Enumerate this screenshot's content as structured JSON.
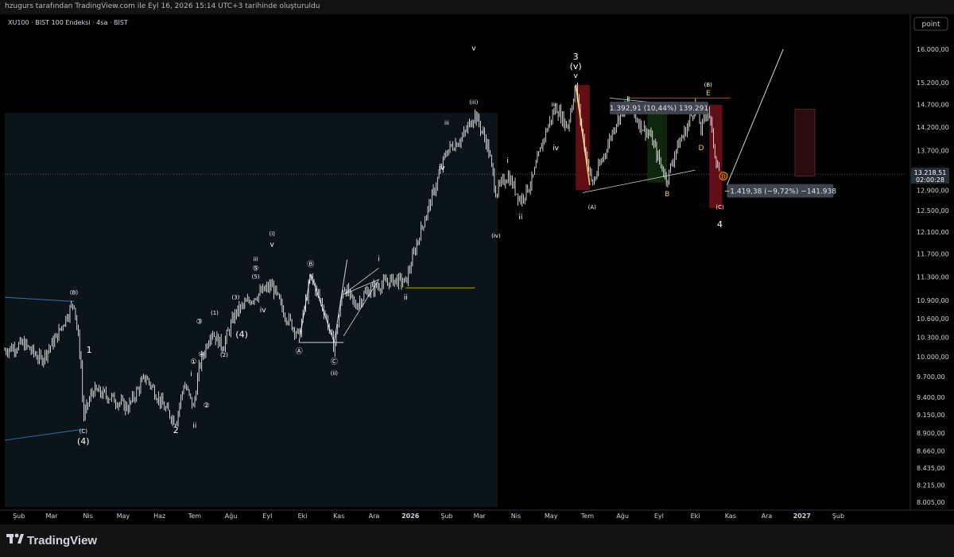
{
  "header": {
    "caption": "hzugurs tarafından TradingView.com ile Eyl 16, 2026 15:14 UTC+3 tarihinde oluşturuldu"
  },
  "chart_title": "XU100 · BIST 100 Endeksi · 4sa · BIST",
  "scale_button": "point",
  "footer": {
    "brand": "TradingView"
  },
  "colors": {
    "background": "#000000",
    "candle": "#ffffff",
    "highlight_zone": "#0b1418",
    "red_box": "#6b0f18",
    "green_box": "#0f2a10",
    "yellow": "#f5d142",
    "orange": "#f0842c",
    "trend_blue": "#3a6ea8"
  },
  "chart_data": {
    "type": "candlestick",
    "title": "XU100 · BIST 100 Endeksi · 4sa · BIST",
    "y_scale": "log",
    "ylim": [
      8005,
      16000
    ],
    "y_ticks": [
      "16.000,00",
      "15.200,00",
      "14.700,00",
      "14.200,00",
      "13.700,00",
      "13.218,51",
      "12.900,00",
      "12.500,00",
      "12.100,00",
      "11.700,00",
      "11.300,00",
      "10.900,00",
      "10.600,00",
      "10.300,00",
      "10.000,00",
      "9.700,00",
      "9.400,00",
      "9.150,00",
      "8.900,00",
      "8.660,00",
      "8.435,00",
      "8.215,00",
      "8.005,00"
    ],
    "x_ticks": [
      "Şub",
      "Mar",
      "Nis",
      "May",
      "Haz",
      "Tem",
      "Ağu",
      "Eyl",
      "Eki",
      "Kas",
      "Ara",
      "2026",
      "Şub",
      "Mar",
      "Nis",
      "May",
      "Tem",
      "Ağu",
      "Eyl",
      "Eki",
      "Kas",
      "Ara",
      "2027",
      "Şub"
    ],
    "xlim": [
      "2025-01-20",
      "2027-02-28"
    ],
    "current_price": "13.218,51",
    "countdown": "02:00:28",
    "closes": [
      [
        "2025-01-20",
        10100
      ],
      [
        "2025-02-05",
        10200
      ],
      [
        "2025-02-20",
        9950
      ],
      [
        "2025-03-05",
        10300
      ],
      [
        "2025-03-20",
        10880
      ],
      [
        "2025-03-26",
        9900
      ],
      [
        "2025-03-28",
        9100
      ],
      [
        "2025-04-05",
        9500
      ],
      [
        "2025-04-20",
        9400
      ],
      [
        "2025-05-05",
        9250
      ],
      [
        "2025-05-20",
        9700
      ],
      [
        "2025-06-05",
        9250
      ],
      [
        "2025-06-15",
        9050
      ],
      [
        "2025-06-22",
        9600
      ],
      [
        "2025-06-30",
        9250
      ],
      [
        "2025-07-05",
        9850
      ],
      [
        "2025-07-15",
        10400
      ],
      [
        "2025-07-25",
        10150
      ],
      [
        "2025-08-05",
        10700
      ],
      [
        "2025-08-20",
        10950
      ],
      [
        "2025-09-05",
        11150
      ],
      [
        "2025-09-15",
        10700
      ],
      [
        "2025-09-28",
        10320
      ],
      [
        "2025-10-08",
        11300
      ],
      [
        "2025-10-20",
        10700
      ],
      [
        "2025-10-28",
        10120
      ],
      [
        "2025-11-05",
        11150
      ],
      [
        "2025-11-15",
        10800
      ],
      [
        "2025-11-25",
        11050
      ],
      [
        "2025-12-05",
        11150
      ],
      [
        "2025-12-18",
        11250
      ],
      [
        "2025-12-28",
        11200
      ],
      [
        "2026-01-08",
        12000
      ],
      [
        "2026-01-20",
        12800
      ],
      [
        "2026-02-01",
        13700
      ],
      [
        "2026-02-15",
        14000
      ],
      [
        "2026-02-25",
        14500
      ],
      [
        "2026-03-08",
        13800
      ],
      [
        "2026-03-15",
        12850
      ],
      [
        "2026-03-25",
        13200
      ],
      [
        "2026-04-05",
        12700
      ],
      [
        "2026-04-15",
        13100
      ],
      [
        "2026-04-25",
        14000
      ],
      [
        "2026-05-05",
        14650
      ],
      [
        "2026-05-15",
        14200
      ],
      [
        "2026-05-22",
        15150
      ],
      [
        "2026-05-28",
        14000
      ],
      [
        "2026-06-05",
        13000
      ],
      [
        "2026-06-15",
        13600
      ],
      [
        "2026-06-25",
        14300
      ],
      [
        "2026-07-05",
        14750
      ],
      [
        "2026-07-15",
        14300
      ],
      [
        "2026-07-25",
        14000
      ],
      [
        "2026-08-01",
        13500
      ],
      [
        "2026-08-08",
        13100
      ],
      [
        "2026-08-15",
        13700
      ],
      [
        "2026-08-25",
        14200
      ],
      [
        "2026-09-01",
        14700
      ],
      [
        "2026-09-06",
        14150
      ],
      [
        "2026-09-12",
        14650
      ],
      [
        "2026-09-18",
        13600
      ],
      [
        "2026-09-22",
        13200
      ]
    ],
    "measures": [
      {
        "text": "1.392,91 (10,44%) 139.291",
        "from": 13022,
        "to": 14415
      },
      {
        "text": "−1.419,38 (−9,72%) −141.938",
        "from": 14600,
        "to": 13180
      }
    ],
    "wave_labels": [
      {
        "t": "2025-03-20",
        "v": 10880,
        "text": "(B)",
        "pos": "above"
      },
      {
        "t": "2025-03-28",
        "v": 9050,
        "text": "(C)",
        "pos": "below"
      },
      {
        "t": "2025-03-28",
        "v": 9050,
        "text": "(4)",
        "pos": "below2"
      },
      {
        "t": "2025-04-02",
        "v": 9950,
        "text": "1",
        "pos": "above"
      },
      {
        "t": "2025-06-15",
        "v": 9050,
        "text": "2",
        "pos": "below"
      },
      {
        "t": "2025-07-01",
        "v": 9120,
        "text": "ii",
        "pos": "below"
      },
      {
        "t": "2025-06-28",
        "v": 9600,
        "text": "i",
        "pos": "above"
      },
      {
        "t": "2025-07-03",
        "v": 9250,
        "text": "②",
        "pos": "right"
      },
      {
        "t": "2025-06-30",
        "v": 9780,
        "text": "①",
        "pos": "above"
      },
      {
        "t": "2025-07-05",
        "v": 10400,
        "text": "③",
        "pos": "above"
      },
      {
        "t": "2025-07-15",
        "v": 10000,
        "text": "④",
        "pos": "left"
      },
      {
        "t": "2025-07-18",
        "v": 10000,
        "text": "(2)",
        "pos": "right"
      },
      {
        "t": "2025-07-18",
        "v": 10550,
        "text": "(1)",
        "pos": "above"
      },
      {
        "t": "2025-08-05",
        "v": 10800,
        "text": "(3)",
        "pos": "above"
      },
      {
        "t": "2025-08-02",
        "v": 10300,
        "text": "(4)",
        "pos": "right"
      },
      {
        "t": "2025-08-20",
        "v": 10700,
        "text": "iv",
        "pos": "right"
      },
      {
        "t": "2025-08-22",
        "v": 11280,
        "text": "⑤",
        "pos": "above"
      },
      {
        "t": "2025-08-22",
        "v": 11150,
        "text": "(5)",
        "pos": "above"
      },
      {
        "t": "2025-08-22",
        "v": 11450,
        "text": "iii",
        "pos": "above"
      },
      {
        "t": "2025-09-05",
        "v": 11700,
        "text": "v",
        "pos": "above"
      },
      {
        "t": "2025-09-05",
        "v": 11900,
        "text": "(i)",
        "pos": "above"
      },
      {
        "t": "2025-09-28",
        "v": 10220,
        "text": "Ⓐ",
        "pos": "below"
      },
      {
        "t": "2025-10-08",
        "v": 11350,
        "text": "Ⓑ",
        "pos": "above"
      },
      {
        "t": "2025-10-28",
        "v": 10060,
        "text": "Ⓒ",
        "pos": "below"
      },
      {
        "t": "2025-10-28",
        "v": 10060,
        "text": "(ii)",
        "pos": "below2"
      },
      {
        "t": "2025-12-05",
        "v": 11450,
        "text": "i",
        "pos": "above"
      },
      {
        "t": "2025-12-28",
        "v": 11100,
        "text": "ii",
        "pos": "below"
      },
      {
        "t": "2026-02-01",
        "v": 14100,
        "text": "iii",
        "pos": "above"
      },
      {
        "t": "2026-02-05",
        "v": 13300,
        "text": "iv",
        "pos": "left"
      },
      {
        "t": "2026-02-24",
        "v": 14550,
        "text": "(iii)",
        "pos": "above"
      },
      {
        "t": "2026-02-24",
        "v": 15800,
        "text": "v",
        "pos": "above"
      },
      {
        "t": "2026-03-25",
        "v": 13300,
        "text": "i",
        "pos": "above"
      },
      {
        "t": "2026-04-05",
        "v": 12550,
        "text": "ii",
        "pos": "below"
      },
      {
        "t": "2026-03-15",
        "v": 12200,
        "text": "(iv)",
        "pos": "below"
      },
      {
        "t": "2026-05-03",
        "v": 14500,
        "text": "iii",
        "pos": "above"
      },
      {
        "t": "2026-05-05",
        "v": 13950,
        "text": "iv",
        "pos": "below"
      },
      {
        "t": "2026-05-22",
        "v": 15150,
        "text": "v",
        "pos": "above"
      },
      {
        "t": "2026-05-22",
        "v": 15150,
        "text": "(v)",
        "pos": "above2"
      },
      {
        "t": "2026-05-22",
        "v": 15150,
        "text": "3",
        "pos": "above3"
      },
      {
        "t": "2026-06-05",
        "v": 12750,
        "text": "(A)",
        "pos": "below"
      },
      {
        "t": "2026-08-08",
        "v": 13000,
        "text": "B",
        "pos": "below"
      },
      {
        "t": "2026-09-06",
        "v": 13950,
        "text": "D",
        "pos": "below"
      },
      {
        "t": "2026-09-12",
        "v": 14750,
        "text": "E",
        "pos": "above"
      },
      {
        "t": "2026-09-12",
        "v": 14950,
        "text": "(B)",
        "pos": "above"
      },
      {
        "t": "2026-09-22",
        "v": 12750,
        "text": "(C)",
        "pos": "below"
      },
      {
        "t": "2026-09-22",
        "v": 12400,
        "text": "4",
        "pos": "below"
      }
    ]
  }
}
